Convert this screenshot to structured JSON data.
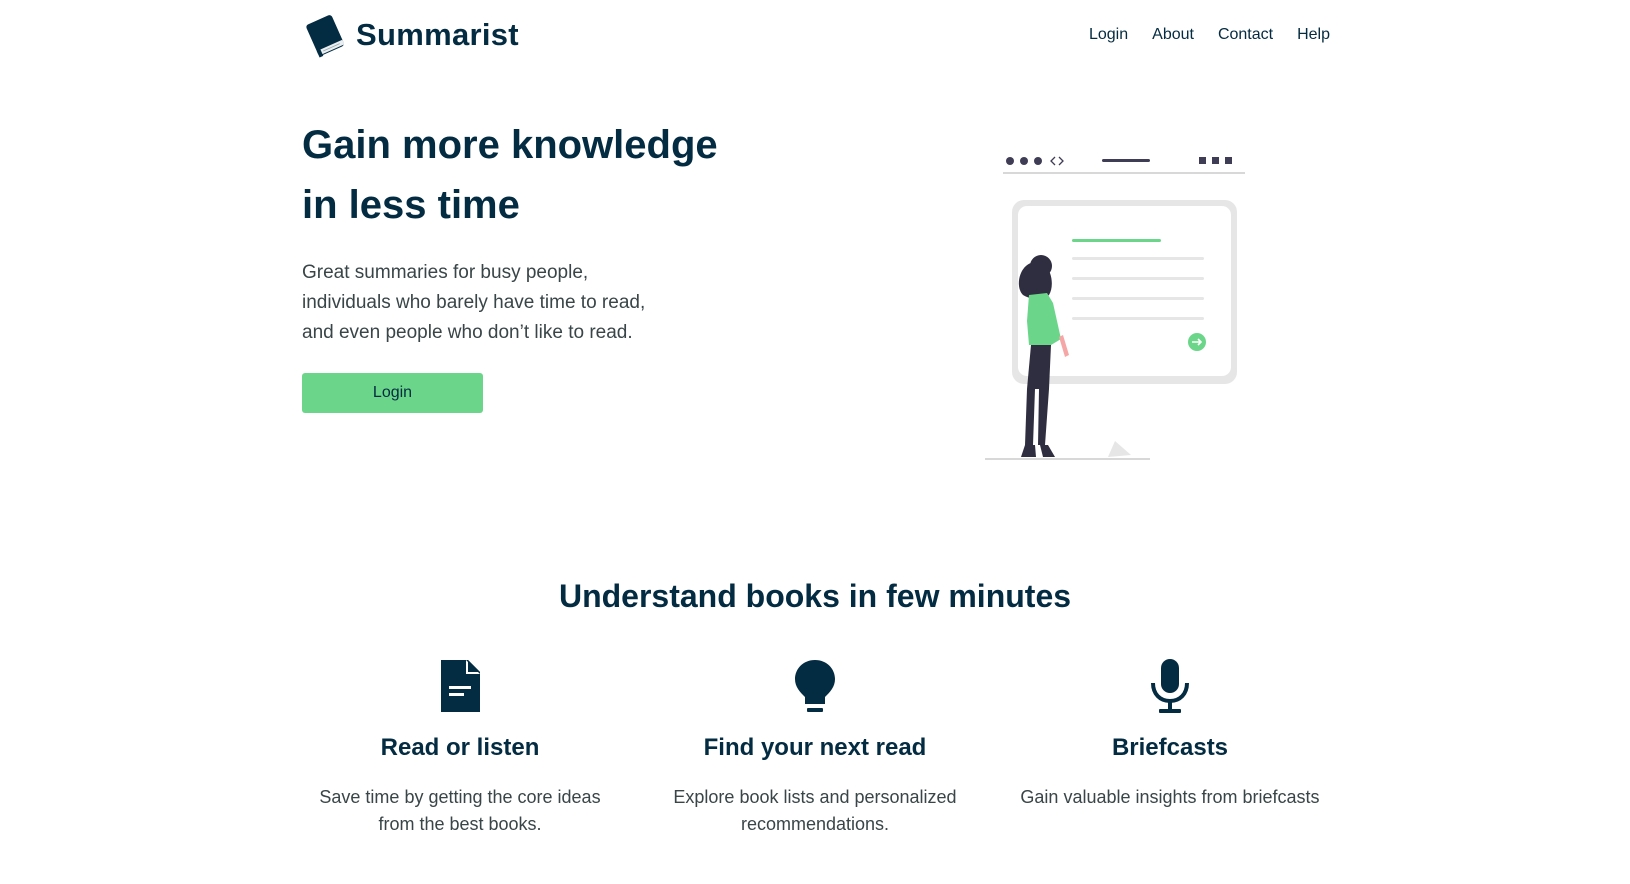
{
  "nav": {
    "logo_text": "Summarist",
    "links": [
      "Login",
      "About",
      "Contact",
      "Help"
    ]
  },
  "hero": {
    "title_line1": "Gain more knowledge",
    "title_line2": "in less time",
    "subtitle_line1": "Great summaries for busy people,",
    "subtitle_line2": "individuals who barely have time to read,",
    "subtitle_line3": "and even people who don’t like to read.",
    "button_label": "Login"
  },
  "features": {
    "heading": "Understand books in few minutes",
    "items": [
      {
        "icon": "document-icon",
        "title": "Read or listen",
        "text_line1": "Save time by getting the core ideas",
        "text_line2": "from the best books."
      },
      {
        "icon": "lightbulb-icon",
        "title": "Find your next read",
        "text_line1": "Explore book lists and personalized",
        "text_line2": "recommendations."
      },
      {
        "icon": "microphone-icon",
        "title": "Briefcasts",
        "text_line1": "Gain valuable insights from briefcasts",
        "text_line2": ""
      }
    ]
  },
  "colors": {
    "primary_text": "#032b41",
    "accent_green": "#6bd68a",
    "body_text": "#394547"
  }
}
